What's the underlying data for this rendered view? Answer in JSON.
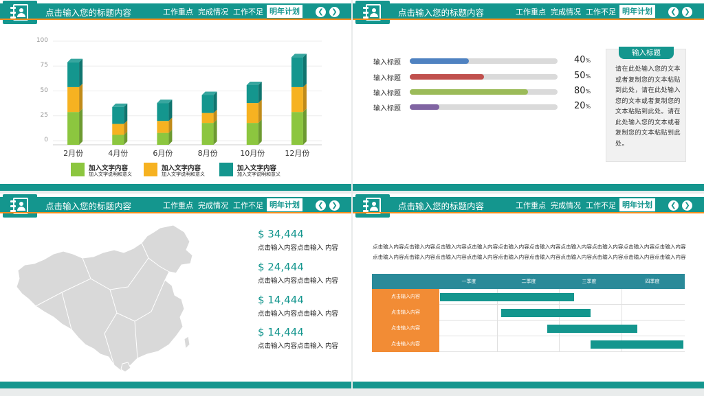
{
  "header": {
    "title": "点击输入您的标题内容",
    "nav": [
      "工作重点",
      "完成情况",
      "工作不足"
    ],
    "active": "明年计划",
    "prev": "❮",
    "next": "❯"
  },
  "slide1": {
    "chart_data": {
      "type": "bar",
      "stacked": true,
      "categories": [
        "2月份",
        "4月份",
        "6月份",
        "8月份",
        "10月份",
        "12月份"
      ],
      "series": [
        {
          "name": "加入文字内容",
          "color": "#8cc63f",
          "values": [
            33,
            10,
            12,
            22,
            22,
            33
          ]
        },
        {
          "name": "加入文字内容",
          "color": "#f6b221",
          "values": [
            25,
            11,
            12,
            10,
            20,
            25
          ]
        },
        {
          "name": "加入文字内容",
          "color": "#14968e",
          "values": [
            25,
            17,
            18,
            18,
            18,
            30
          ]
        }
      ],
      "yticks": [
        "100",
        "75",
        "50",
        "25",
        "0"
      ],
      "ylim": [
        0,
        100
      ]
    },
    "legend": [
      {
        "title": "加入文字内容",
        "desc": "加入文字说明和意义",
        "color": "#8cc63f"
      },
      {
        "title": "加入文字内容",
        "desc": "加入文字说明和意义",
        "color": "#f6b221"
      },
      {
        "title": "加入文字内容",
        "desc": "加入文字说明和意义",
        "color": "#14968e"
      }
    ]
  },
  "slide2": {
    "bars": [
      {
        "label": "输入标题",
        "value": 40,
        "unit": "%",
        "color": "#4f82c1"
      },
      {
        "label": "输入标题",
        "value": 50,
        "unit": "%",
        "color": "#c0504d"
      },
      {
        "label": "输入标题",
        "value": 80,
        "unit": "%",
        "color": "#9bbb59"
      },
      {
        "label": "输入标题",
        "value": 20,
        "unit": "%",
        "color": "#8064a2"
      }
    ],
    "box_title": "输入标题",
    "box_text": "请在此处输入您的文本或者复制您的文本粘贴到此处，请在此处输入您的文本或者复制您的文本粘贴到此处。请在此处输入您的文本或者复制您的文本粘贴到此处。"
  },
  "slide3": {
    "items": [
      {
        "price": "$ 34,444",
        "desc": "点击输入内容点击输入 内容"
      },
      {
        "price": "$ 24,444",
        "desc": "点击输入内容点击输入 内容"
      },
      {
        "price": "$ 14,444",
        "desc": "点击输入内容点击输入 内容"
      },
      {
        "price": "$ 14,444",
        "desc": "点击输入内容点击输入 内容"
      }
    ]
  },
  "slide4": {
    "paragraph": "点击输入内容点击输入内容点击输入内容点击输入内容点击输入内容点击输入内容点击输入内容点击输入内容点击输入内容点击输入内容点击输入内容点击输入内容点击输入内容点击输入内容点击输入内容点击输入内容点击输入内容点击输入内容点击输入内容点击输入内容",
    "paragraph_line1": "点击输入内容点击输入内容点击输入内容点击输入内容点击输入内容点击输入内容点击输入内容点击输入内容点击输入内容点击输入内容",
    "paragraph_line2": "点击输入内容点击输入内容点击输入内容点击输入内容点击输入内容点击输入内容点击输入内容点击输入内容点击输入内容点击输入内容",
    "quarters": [
      "一季度",
      "二季度",
      "三季度",
      "四季度"
    ],
    "rows": [
      {
        "label": "点击输入内容",
        "start": 0.0,
        "end": 0.55
      },
      {
        "label": "点击输入内容",
        "start": 0.25,
        "end": 0.62
      },
      {
        "label": "点击输入内容",
        "start": 0.44,
        "end": 0.81
      },
      {
        "label": "点击输入内容",
        "start": 0.62,
        "end": 1.0
      }
    ]
  }
}
